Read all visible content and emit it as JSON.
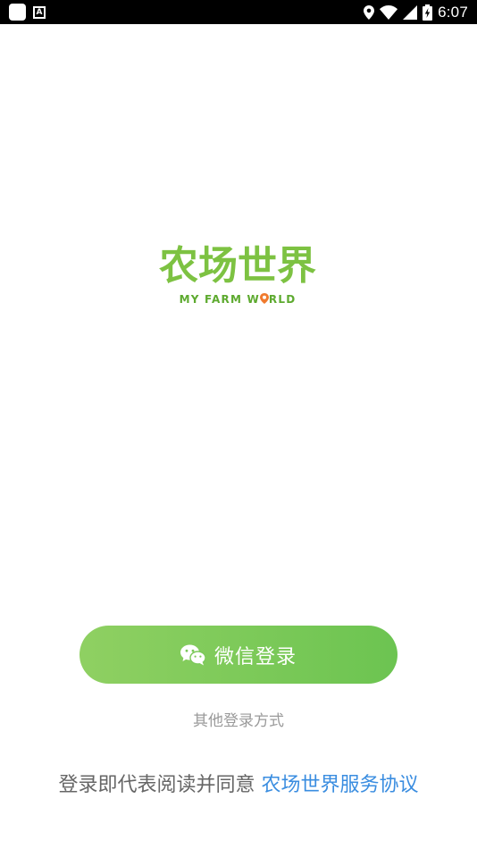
{
  "status_bar": {
    "time": "6:07",
    "icons": [
      "app-icon",
      "a-notification-icon",
      "location-icon",
      "wifi-icon",
      "signal-icon",
      "battery-charging-icon"
    ]
  },
  "logo": {
    "chinese": "农场世界",
    "english_before": "MY FARM W",
    "english_after": "RLD",
    "colors": {
      "green": "#7dc242",
      "pin": "#f07a2e"
    }
  },
  "login": {
    "wechat_label": "微信登录",
    "wechat_icon": "wechat-icon",
    "other_label": "其他登录方式"
  },
  "agreement": {
    "prefix": "登录即代表阅读并同意 ",
    "link": "农场世界服务协议"
  },
  "colors": {
    "button_start": "#8fd062",
    "button_end": "#6cc451",
    "link": "#3a8de0",
    "muted_text": "#9a9a9a"
  }
}
